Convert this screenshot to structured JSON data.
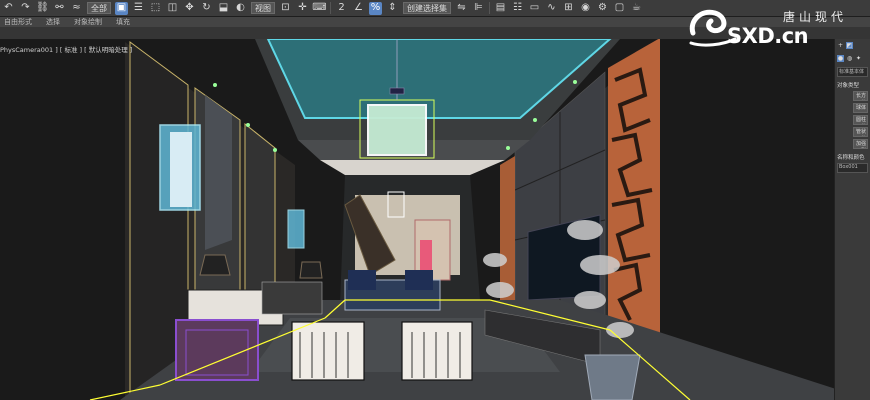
{
  "toolbar": {
    "selection_filter": "全部",
    "reference_coord": "视图",
    "named_selection": "创建选择集"
  },
  "ribbon": {
    "tabs": [
      "自由形式",
      "选择",
      "对象绘制",
      "填充"
    ]
  },
  "viewport": {
    "label": "PhysCamera001 ] [ 标准 ] [ 默认明暗处理 ]"
  },
  "command_panel": {
    "object_name": "标准基本体",
    "section_object_type": "对象类型",
    "section_name_color": "名称和颜色",
    "name_field": "Box001",
    "buttons": [
      "长方体",
      "球体",
      "圆柱体",
      "管状体",
      "加强型"
    ]
  },
  "logo": {
    "latin": "SXD.cn",
    "chinese": "唐山现代"
  }
}
